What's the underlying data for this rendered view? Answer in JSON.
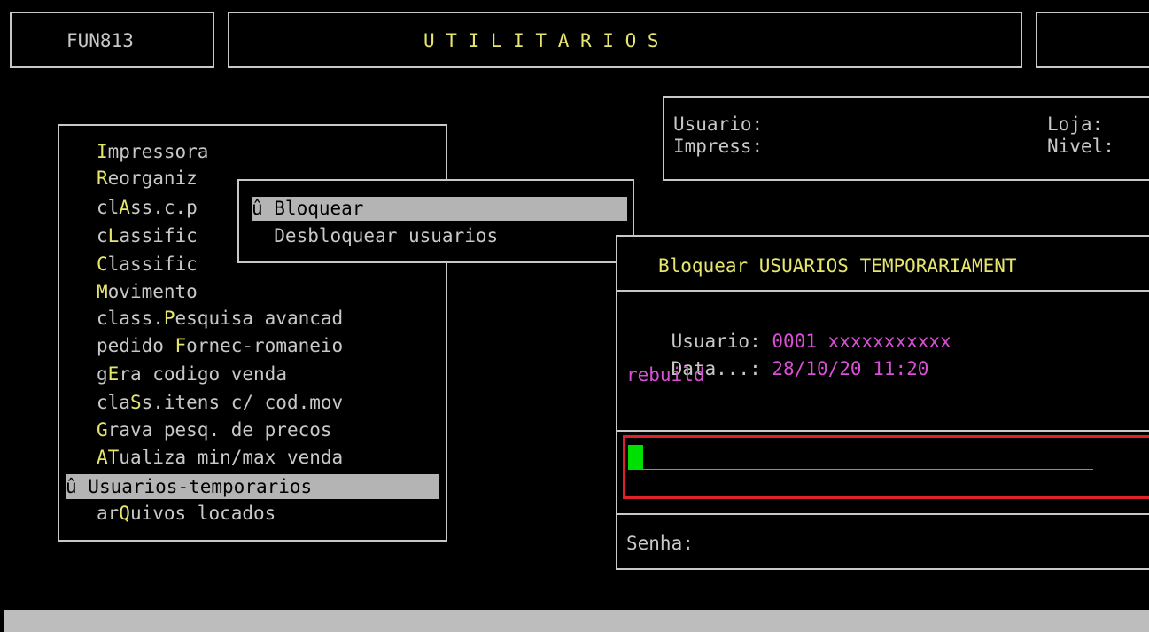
{
  "header": {
    "code": "FUN813",
    "title": "U T I L I T A R I O S"
  },
  "info": {
    "usuario_label": "Usuario:",
    "loja_label": "Loja:",
    "impress_label": "Impress:",
    "nivel_label": "Nivel:"
  },
  "menu": {
    "items": [
      {
        "pre": "",
        "key": "I",
        "post": "mpressora"
      },
      {
        "pre": "",
        "key": "R",
        "post": "eorganiz"
      },
      {
        "pre": "cl",
        "key": "A",
        "post": "ss.c.p"
      },
      {
        "pre": "c",
        "key": "L",
        "post": "assific"
      },
      {
        "pre": "",
        "key": "C",
        "post": "lassific"
      },
      {
        "pre": "",
        "key": "M",
        "post": "ovimento"
      },
      {
        "pre": "class.",
        "key": "P",
        "post": "esquisa avancad"
      },
      {
        "pre": "pedido ",
        "key": "F",
        "post": "ornec-romaneio"
      },
      {
        "pre": "g",
        "key": "E",
        "post": "ra codigo venda"
      },
      {
        "pre": "cla",
        "key": "S",
        "post": "s.itens c/ cod.mov"
      },
      {
        "pre": "",
        "key": "G",
        "post": "rava pesq. de precos"
      },
      {
        "pre": "",
        "key": "AT",
        "post": "ualiza min/max venda"
      },
      {
        "pre": "û ",
        "key": "U",
        "post": "suarios-temporarios"
      },
      {
        "pre": "ar",
        "key": "Q",
        "post": "uivos locados"
      }
    ]
  },
  "submenu": {
    "items": [
      {
        "label": "û Bloquear"
      },
      {
        "label": "  Desbloquear usuarios"
      }
    ]
  },
  "dialog": {
    "title": "Bloquear USUARIOS TEMPORARIAMENT",
    "usuario_label": "Usuario: ",
    "usuario_value": "0001 xxxxxxxxxxx",
    "data_label": "Data...: ",
    "data_value": "28/10/20 11:20",
    "note": "rebuild",
    "senha_label": "Senha:"
  },
  "colors": {
    "hotkey": "#e6e66e",
    "value": "#d94fd6",
    "selection": "#b4b4b4",
    "input_border": "#e0202a",
    "cursor": "#00e000",
    "input_line": "#3ab0b0"
  }
}
